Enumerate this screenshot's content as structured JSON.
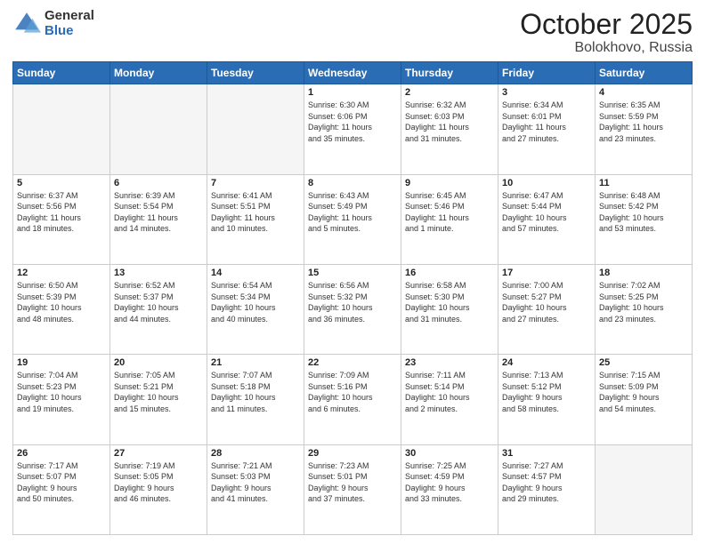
{
  "header": {
    "logo_general": "General",
    "logo_blue": "Blue",
    "title": "October 2025",
    "location": "Bolokhovo, Russia"
  },
  "days_of_week": [
    "Sunday",
    "Monday",
    "Tuesday",
    "Wednesday",
    "Thursday",
    "Friday",
    "Saturday"
  ],
  "weeks": [
    [
      {
        "day": "",
        "info": ""
      },
      {
        "day": "",
        "info": ""
      },
      {
        "day": "",
        "info": ""
      },
      {
        "day": "1",
        "info": "Sunrise: 6:30 AM\nSunset: 6:06 PM\nDaylight: 11 hours\nand 35 minutes."
      },
      {
        "day": "2",
        "info": "Sunrise: 6:32 AM\nSunset: 6:03 PM\nDaylight: 11 hours\nand 31 minutes."
      },
      {
        "day": "3",
        "info": "Sunrise: 6:34 AM\nSunset: 6:01 PM\nDaylight: 11 hours\nand 27 minutes."
      },
      {
        "day": "4",
        "info": "Sunrise: 6:35 AM\nSunset: 5:59 PM\nDaylight: 11 hours\nand 23 minutes."
      }
    ],
    [
      {
        "day": "5",
        "info": "Sunrise: 6:37 AM\nSunset: 5:56 PM\nDaylight: 11 hours\nand 18 minutes."
      },
      {
        "day": "6",
        "info": "Sunrise: 6:39 AM\nSunset: 5:54 PM\nDaylight: 11 hours\nand 14 minutes."
      },
      {
        "day": "7",
        "info": "Sunrise: 6:41 AM\nSunset: 5:51 PM\nDaylight: 11 hours\nand 10 minutes."
      },
      {
        "day": "8",
        "info": "Sunrise: 6:43 AM\nSunset: 5:49 PM\nDaylight: 11 hours\nand 5 minutes."
      },
      {
        "day": "9",
        "info": "Sunrise: 6:45 AM\nSunset: 5:46 PM\nDaylight: 11 hours\nand 1 minute."
      },
      {
        "day": "10",
        "info": "Sunrise: 6:47 AM\nSunset: 5:44 PM\nDaylight: 10 hours\nand 57 minutes."
      },
      {
        "day": "11",
        "info": "Sunrise: 6:48 AM\nSunset: 5:42 PM\nDaylight: 10 hours\nand 53 minutes."
      }
    ],
    [
      {
        "day": "12",
        "info": "Sunrise: 6:50 AM\nSunset: 5:39 PM\nDaylight: 10 hours\nand 48 minutes."
      },
      {
        "day": "13",
        "info": "Sunrise: 6:52 AM\nSunset: 5:37 PM\nDaylight: 10 hours\nand 44 minutes."
      },
      {
        "day": "14",
        "info": "Sunrise: 6:54 AM\nSunset: 5:34 PM\nDaylight: 10 hours\nand 40 minutes."
      },
      {
        "day": "15",
        "info": "Sunrise: 6:56 AM\nSunset: 5:32 PM\nDaylight: 10 hours\nand 36 minutes."
      },
      {
        "day": "16",
        "info": "Sunrise: 6:58 AM\nSunset: 5:30 PM\nDaylight: 10 hours\nand 31 minutes."
      },
      {
        "day": "17",
        "info": "Sunrise: 7:00 AM\nSunset: 5:27 PM\nDaylight: 10 hours\nand 27 minutes."
      },
      {
        "day": "18",
        "info": "Sunrise: 7:02 AM\nSunset: 5:25 PM\nDaylight: 10 hours\nand 23 minutes."
      }
    ],
    [
      {
        "day": "19",
        "info": "Sunrise: 7:04 AM\nSunset: 5:23 PM\nDaylight: 10 hours\nand 19 minutes."
      },
      {
        "day": "20",
        "info": "Sunrise: 7:05 AM\nSunset: 5:21 PM\nDaylight: 10 hours\nand 15 minutes."
      },
      {
        "day": "21",
        "info": "Sunrise: 7:07 AM\nSunset: 5:18 PM\nDaylight: 10 hours\nand 11 minutes."
      },
      {
        "day": "22",
        "info": "Sunrise: 7:09 AM\nSunset: 5:16 PM\nDaylight: 10 hours\nand 6 minutes."
      },
      {
        "day": "23",
        "info": "Sunrise: 7:11 AM\nSunset: 5:14 PM\nDaylight: 10 hours\nand 2 minutes."
      },
      {
        "day": "24",
        "info": "Sunrise: 7:13 AM\nSunset: 5:12 PM\nDaylight: 9 hours\nand 58 minutes."
      },
      {
        "day": "25",
        "info": "Sunrise: 7:15 AM\nSunset: 5:09 PM\nDaylight: 9 hours\nand 54 minutes."
      }
    ],
    [
      {
        "day": "26",
        "info": "Sunrise: 7:17 AM\nSunset: 5:07 PM\nDaylight: 9 hours\nand 50 minutes."
      },
      {
        "day": "27",
        "info": "Sunrise: 7:19 AM\nSunset: 5:05 PM\nDaylight: 9 hours\nand 46 minutes."
      },
      {
        "day": "28",
        "info": "Sunrise: 7:21 AM\nSunset: 5:03 PM\nDaylight: 9 hours\nand 41 minutes."
      },
      {
        "day": "29",
        "info": "Sunrise: 7:23 AM\nSunset: 5:01 PM\nDaylight: 9 hours\nand 37 minutes."
      },
      {
        "day": "30",
        "info": "Sunrise: 7:25 AM\nSunset: 4:59 PM\nDaylight: 9 hours\nand 33 minutes."
      },
      {
        "day": "31",
        "info": "Sunrise: 7:27 AM\nSunset: 4:57 PM\nDaylight: 9 hours\nand 29 minutes."
      },
      {
        "day": "",
        "info": ""
      }
    ]
  ]
}
